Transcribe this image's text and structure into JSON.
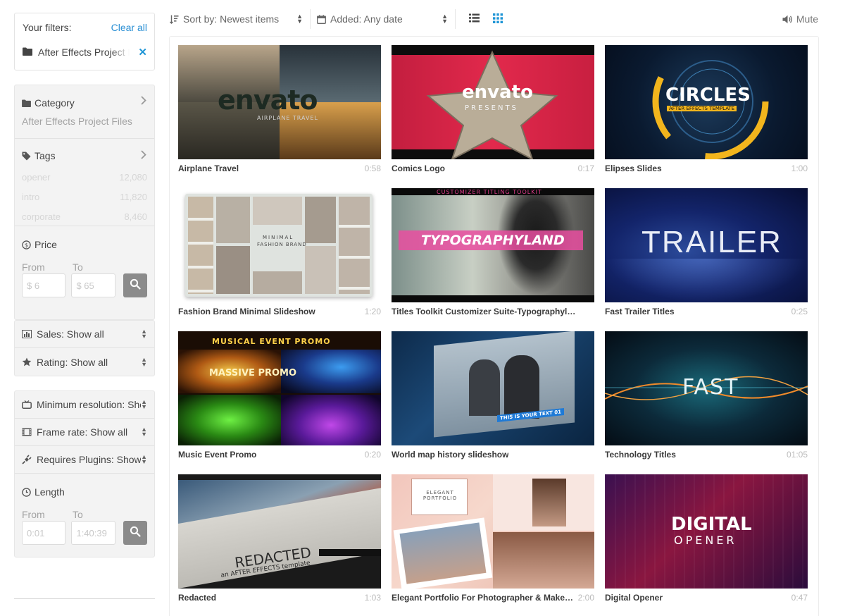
{
  "filters": {
    "heading": "Your filters:",
    "clear_label": "Clear all",
    "active_filter": "After Effects Project Files"
  },
  "category": {
    "label": "Category",
    "value": "After Effects Project Files"
  },
  "tags": {
    "label": "Tags",
    "items": [
      {
        "name": "opener",
        "count": "12,080"
      },
      {
        "name": "intro",
        "count": "11,820"
      },
      {
        "name": "corporate",
        "count": "8,460"
      }
    ]
  },
  "price": {
    "label": "Price",
    "from_label": "From",
    "to_label": "To",
    "from_placeholder": "$ 6",
    "to_placeholder": "$ 65"
  },
  "selects_a": [
    {
      "label": "Sales: Show all",
      "icon": "bar-chart-icon"
    },
    {
      "label": "Rating: Show all",
      "icon": "star-icon"
    }
  ],
  "selects_b": [
    {
      "label": "Minimum resolution: Show all",
      "icon": "tv-icon"
    },
    {
      "label": "Frame rate: Show all",
      "icon": "film-icon"
    },
    {
      "label": "Requires Plugins: Show all",
      "icon": "plug-icon"
    }
  ],
  "length": {
    "label": "Length",
    "from_label": "From",
    "to_label": "To",
    "from_placeholder": "0:01",
    "to_placeholder": "1:40:39"
  },
  "toolbar": {
    "sort_label": "Sort by: Newest items",
    "date_label": "Added: Any date",
    "mute_label": "Mute"
  },
  "colors": {
    "accent": "#2a8fd4",
    "active_view": "#1f95d6"
  },
  "items": [
    {
      "title": "Airplane Travel",
      "duration": "0:58",
      "overlay": "envato",
      "overlay_sub": "AIRPLANE TRAVEL"
    },
    {
      "title": "Comics Logo",
      "duration": "0:17",
      "overlay": "envato",
      "overlay_sub": "PRESENTS"
    },
    {
      "title": "Elipses Slides",
      "duration": "1:00",
      "overlay": "CIRCLES",
      "overlay_sub": "AFTER EFFECTS TEMPLATE"
    },
    {
      "title": "Fashion Brand Minimal Slideshow",
      "duration": "1:20",
      "overlay": "MINIMAL",
      "overlay_sub": "FASHION BRAND"
    },
    {
      "title": "Titles Toolkit Customizer Suite-Typographyland",
      "duration": "",
      "overlay": "TYPOGRAPHYLAND",
      "overlay_sub": "CUSTOMIZER TITLING TOOLKIT"
    },
    {
      "title": "Fast Trailer Titles",
      "duration": "0:25",
      "overlay": "TRAILER",
      "overlay_sub": ""
    },
    {
      "title": "Music Event Promo",
      "duration": "0:20",
      "overlay": "MUSICAL EVENT PROMO",
      "overlay_sub": "MASSIVE PROMO"
    },
    {
      "title": "World map history slideshow",
      "duration": "",
      "overlay": "THIS IS YOUR TEXT 01",
      "overlay_sub": ""
    },
    {
      "title": "Technology Titles",
      "duration": "01:05",
      "overlay": "FAST",
      "overlay_sub": ""
    },
    {
      "title": "Redacted",
      "duration": "1:03",
      "overlay": "REDACTED",
      "overlay_sub": "an AFTER EFFECTS template"
    },
    {
      "title": "Elegant Portfolio For Photographer & Makeup Artist",
      "duration": "2:00",
      "overlay": "ELEGANT PORTFOLIO",
      "overlay_sub": ""
    },
    {
      "title": "Digital Opener",
      "duration": "0:47",
      "overlay": "DIGITAL",
      "overlay_sub": "OPENER"
    }
  ]
}
